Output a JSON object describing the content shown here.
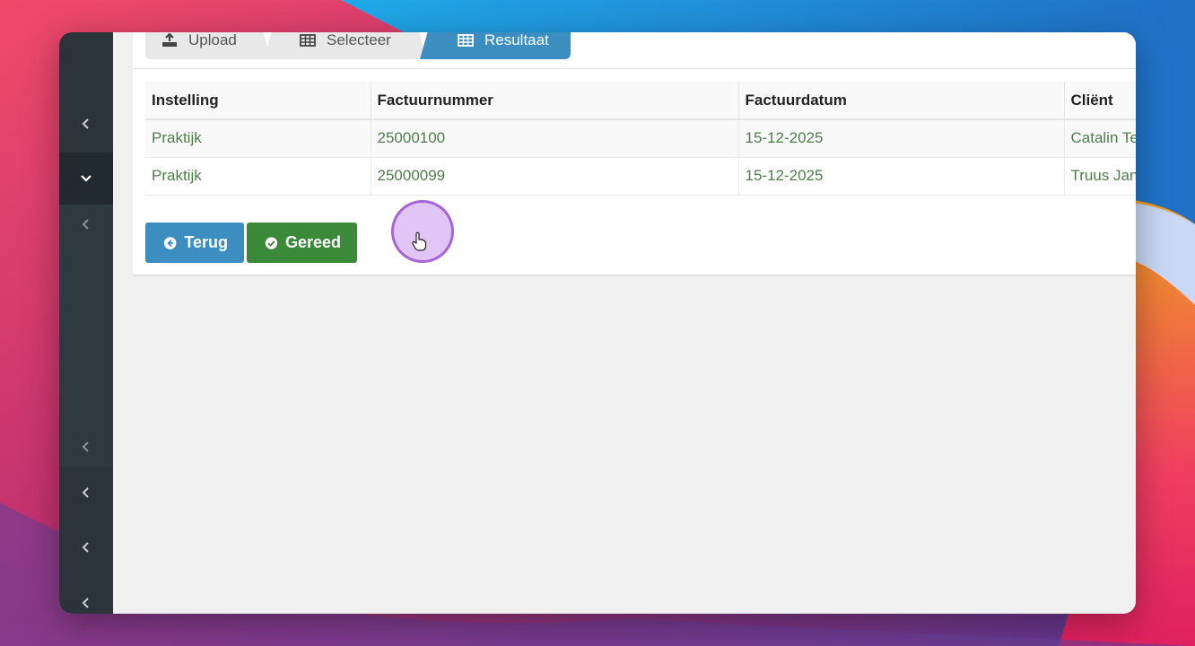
{
  "steps": [
    {
      "label": "Upload",
      "icon": "upload-icon"
    },
    {
      "label": "Selecteer",
      "icon": "table-icon"
    },
    {
      "label": "Resultaat",
      "icon": "table-icon",
      "active": true
    }
  ],
  "table": {
    "headers": [
      "Instelling",
      "Factuurnummer",
      "Factuurdatum",
      "Cliënt"
    ],
    "rows": [
      [
        "Praktijk",
        "25000100",
        "15-12-2025",
        "Catalin Te"
      ],
      [
        "Praktijk",
        "25000099",
        "15-12-2025",
        "Truus Jan"
      ]
    ]
  },
  "buttons": {
    "back_label": "Terug",
    "done_label": "Gereed"
  },
  "colors": {
    "primary": "#3d8ec0",
    "success": "#3a8a3a",
    "link_text": "#4e7d4a",
    "sidebar": "#2b333b"
  }
}
